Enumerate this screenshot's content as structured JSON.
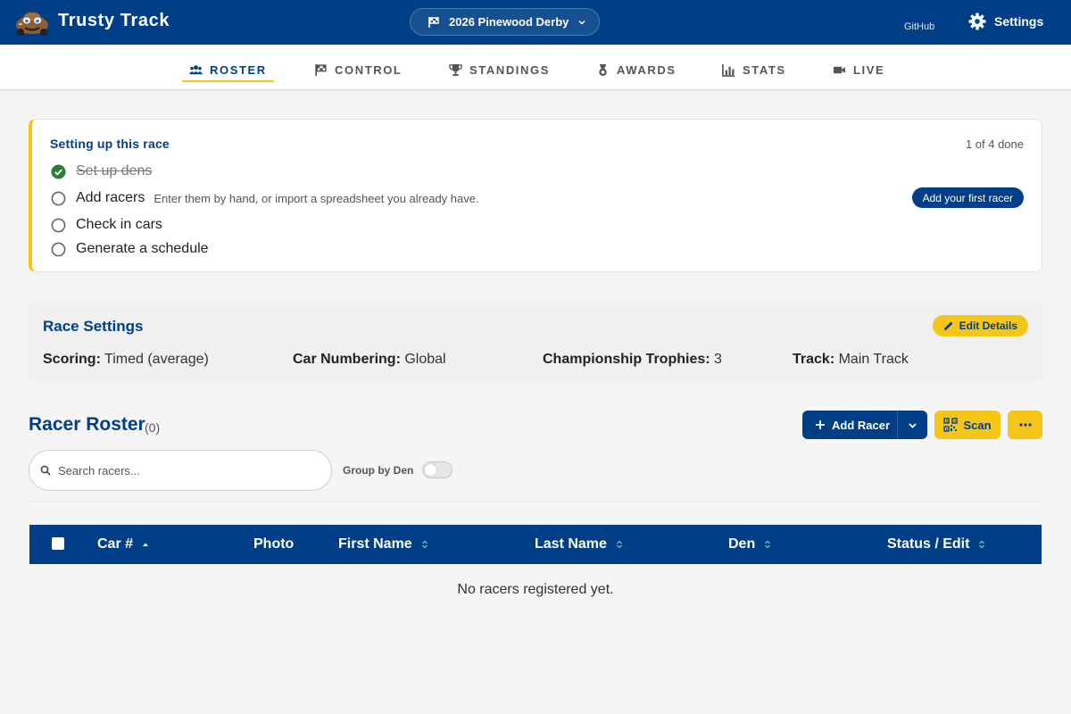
{
  "header": {
    "app_title": "Trusty Track",
    "race_selector": "2026 Pinewood Derby",
    "github_link": "GitHub",
    "settings_label": "Settings"
  },
  "tabs": [
    {
      "label": "ROSTER",
      "icon": "group-icon",
      "active": true
    },
    {
      "label": "CONTROL",
      "icon": "flag-icon",
      "active": false
    },
    {
      "label": "STANDINGS",
      "icon": "trophy-icon",
      "active": false
    },
    {
      "label": "AWARDS",
      "icon": "medal-icon",
      "active": false
    },
    {
      "label": "STATS",
      "icon": "bar-chart-icon",
      "active": false
    },
    {
      "label": "LIVE",
      "icon": "videocam-icon",
      "active": false
    }
  ],
  "setup": {
    "title": "Setting up this race",
    "progress": "1 of 4 done",
    "steps": [
      {
        "label": "Set up dens",
        "done": true,
        "hint": ""
      },
      {
        "label": "Add racers",
        "done": false,
        "hint": "Enter them by hand, or import a spreadsheet you already have."
      },
      {
        "label": "Check in cars",
        "done": false,
        "hint": ""
      },
      {
        "label": "Generate a schedule",
        "done": false,
        "hint": ""
      }
    ],
    "action_button": "Add your first racer"
  },
  "race_settings": {
    "title": "Race Settings",
    "edit_button": "Edit Details",
    "items": [
      {
        "label": "Scoring:",
        "value": "Timed (average)"
      },
      {
        "label": "Car Numbering:",
        "value": "Global"
      },
      {
        "label": "Championship Trophies:",
        "value": "3"
      },
      {
        "label": "Track:",
        "value": "Main Track"
      }
    ]
  },
  "roster": {
    "title": "Racer Roster",
    "count": "(0)",
    "add_button": "Add Racer",
    "scan_button": "Scan",
    "search_placeholder": "Search racers...",
    "group_by_label": "Group by Den",
    "group_by_enabled": false,
    "columns": [
      "Car #",
      "Photo",
      "First Name",
      "Last Name",
      "Den",
      "Status / Edit"
    ],
    "sort_column": "Car #",
    "sort_direction": "ascending",
    "rows": [],
    "empty_message": "No racers registered yet."
  },
  "colors": {
    "primary": "#003f87",
    "accent": "#f5c518",
    "success": "#2e7d32"
  }
}
